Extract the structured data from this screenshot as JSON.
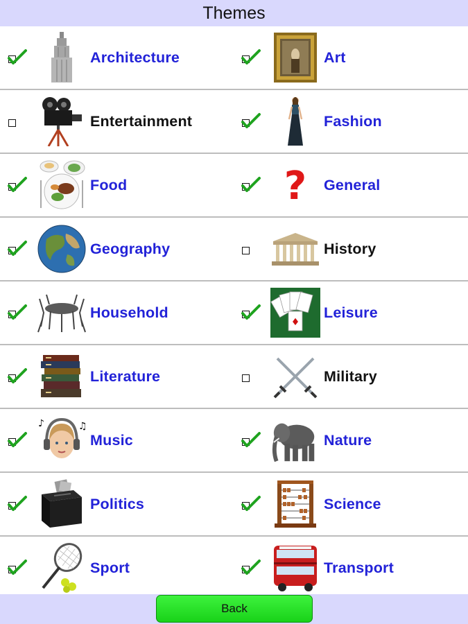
{
  "header": {
    "title": "Themes"
  },
  "themes": [
    {
      "label": "Architecture",
      "checked": true,
      "icon": "skyscraper-icon"
    },
    {
      "label": "Art",
      "checked": true,
      "icon": "framed-painting-icon"
    },
    {
      "label": "Entertainment",
      "checked": false,
      "icon": "movie-camera-icon"
    },
    {
      "label": "Fashion",
      "checked": true,
      "icon": "model-in-dress-icon"
    },
    {
      "label": "Food",
      "checked": true,
      "icon": "food-plates-icon"
    },
    {
      "label": "General",
      "checked": true,
      "icon": "question-mark-icon"
    },
    {
      "label": "Geography",
      "checked": true,
      "icon": "globe-icon"
    },
    {
      "label": "History",
      "checked": false,
      "icon": "greek-temple-icon"
    },
    {
      "label": "Household",
      "checked": true,
      "icon": "table-and-chairs-icon"
    },
    {
      "label": "Leisure",
      "checked": true,
      "icon": "playing-cards-icon"
    },
    {
      "label": "Literature",
      "checked": true,
      "icon": "book-stack-icon"
    },
    {
      "label": "Military",
      "checked": false,
      "icon": "crossed-swords-icon"
    },
    {
      "label": "Music",
      "checked": true,
      "icon": "headphones-girl-icon"
    },
    {
      "label": "Nature",
      "checked": true,
      "icon": "elephant-icon"
    },
    {
      "label": "Politics",
      "checked": true,
      "icon": "ballot-box-icon"
    },
    {
      "label": "Science",
      "checked": true,
      "icon": "abacus-icon"
    },
    {
      "label": "Sport",
      "checked": true,
      "icon": "tennis-racket-icon"
    },
    {
      "label": "Transport",
      "checked": true,
      "icon": "double-decker-bus-icon"
    }
  ],
  "footer": {
    "back_label": "Back"
  },
  "colors": {
    "header_bg": "#d9d8fd",
    "label_checked": "#2222d8",
    "label_unchecked": "#111111",
    "check_mark": "#1fa31f",
    "back_button": "#22dd22"
  }
}
